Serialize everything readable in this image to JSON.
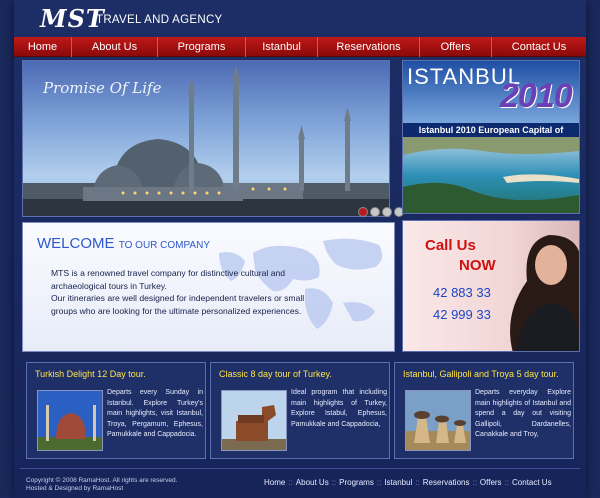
{
  "header": {
    "logo": "MST",
    "tagline": "TRAVEL AND AGENCY"
  },
  "nav": [
    "Home",
    "About Us",
    "Programs",
    "Istanbul",
    "Reservations",
    "Offers",
    "Contact Us"
  ],
  "hero": {
    "title": "Promise Of Life",
    "slides": 4,
    "active_slide": 1
  },
  "promo": {
    "city": "ISTANBUL",
    "year": "2010",
    "caption": "Istanbul 2010 European Capital of Culture"
  },
  "welcome": {
    "title": "WELCOME",
    "subtitle": "TO OUR COMPANY",
    "para1": "MTS is a renowned travel company for distinctive cultural and archaeological tours in Turkey.",
    "para2": "Our itineraries are well designed for independent travelers or small groups who are looking for the ultimate personalized experiences."
  },
  "callus": {
    "title": "Call Us",
    "now": "NOW",
    "phone1": "42 883 33",
    "phone2": "42 999 33"
  },
  "tours": [
    {
      "title": "Turkish Delight 12 Day tour.",
      "desc": "Departs every Sunday in Istanbul. Explore Turkey's main highlights, visit Istanbul, Troya, Pergamum, Ephesus, Pamukkale and Cappadocia."
    },
    {
      "title": "Classic 8 day tour of Turkey.",
      "desc": "Ideal program that including main highlights of Turkey, Explore Istabul, Ephesus, Pamukkale and Cappadocia,"
    },
    {
      "title": "Istanbul, Gallipoli and Troya 5 day tour.",
      "desc": "Departs everyday Explore main highlights of Istanbul and spend a day out visiting Gallipoli, Dardanelles, Canakkale and Troy,"
    }
  ],
  "footer": {
    "copyright": "Copyright © 2008 RamaHost. All rights are reserved.",
    "credit": "Hosted & Designed by RamaHost",
    "links": [
      "Home",
      "About Us",
      "Programs",
      "Istanbul",
      "Reservations",
      "Offers",
      "Contact Us"
    ],
    "separator": "::"
  }
}
